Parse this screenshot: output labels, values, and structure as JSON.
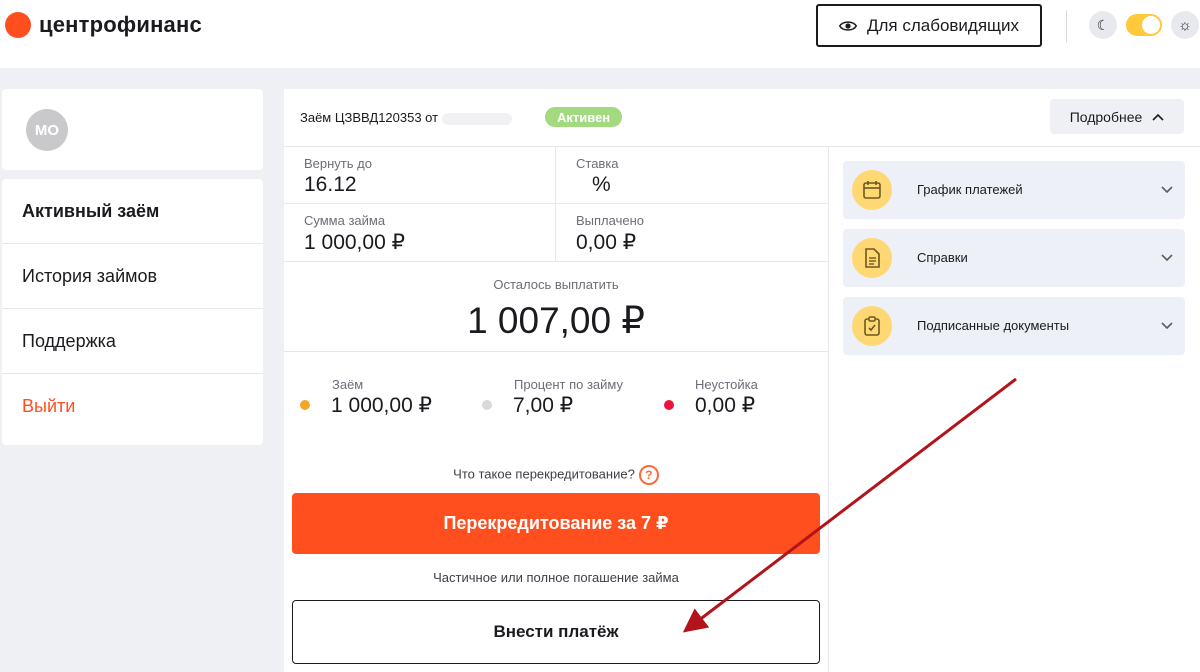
{
  "header": {
    "brand": "центрофинанс",
    "vision_button_label": "Для слабовидящих",
    "theme_dark_icon": "moon-icon",
    "theme_light_icon": "sun-icon",
    "theme_toggle_state": "light"
  },
  "colors": {
    "brand": "#ff4f1e",
    "active_badge": "#a3d97f",
    "accordion_icon_bg": "#ffd873",
    "arrow": "#b3131a"
  },
  "user": {
    "initials": "МО"
  },
  "sidebar": {
    "items": [
      {
        "label": "Активный заём"
      },
      {
        "label": "История займов"
      },
      {
        "label": "Поддержка"
      },
      {
        "label": "Выйти"
      }
    ]
  },
  "loan": {
    "title": "Заём ЦЗВВД120353 от",
    "status": "Активен",
    "details_button": "Подробнее",
    "return_by_label": "Вернуть до",
    "return_by_value": "16.12",
    "rate_label": "Ставка",
    "rate_value": "%",
    "amount_label": "Сумма займа",
    "amount_value": "1 000,00 ₽",
    "paid_label": "Выплачено",
    "paid_value": "0,00 ₽",
    "remaining_label": "Осталось выплатить",
    "remaining_value": "1 007,00 ₽",
    "breakdown": [
      {
        "label": "Заём",
        "value": "1 000,00 ₽",
        "color": "#f5a623"
      },
      {
        "label": "Процент по займу",
        "value": "7,00 ₽",
        "color": "#d9d9dc"
      },
      {
        "label": "Неустойка",
        "value": "0,00 ₽",
        "color": "#e8173a"
      }
    ],
    "refi_question": "Что такое перекредитование?",
    "refi_button": "Перекредитование за 7 ₽",
    "partial_note": "Частичное или полное погашение займа",
    "pay_button": "Внести платёж"
  },
  "accordions": [
    {
      "label": "График платежей",
      "icon": "calendar-icon"
    },
    {
      "label": "Справки",
      "icon": "document-icon"
    },
    {
      "label": "Подписанные документы",
      "icon": "clipboard-check-icon"
    }
  ]
}
